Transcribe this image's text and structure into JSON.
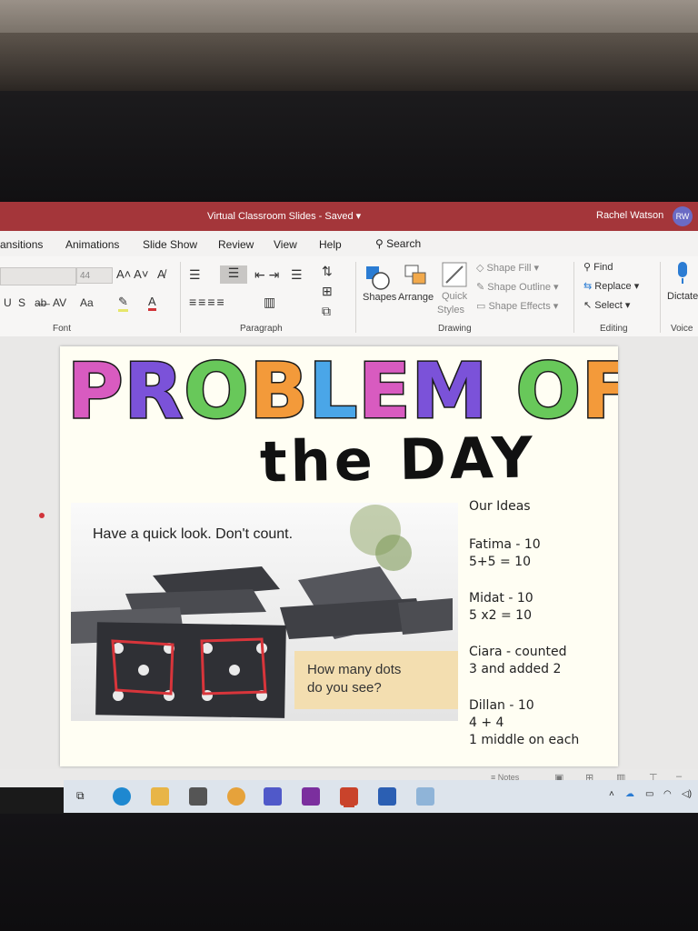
{
  "window": {
    "title": "Virtual Classroom Slides  -  Saved",
    "user": "Rachel Watson",
    "user_initials": "RW"
  },
  "tabs": [
    "ansitions",
    "Animations",
    "Slide Show",
    "Review",
    "View",
    "Help"
  ],
  "search_label": "Search",
  "ribbon": {
    "font_size": "44",
    "groups": [
      "Font",
      "Paragraph",
      "Drawing",
      "Editing",
      "Voice"
    ],
    "drawing": {
      "shapes": "Shapes",
      "arrange": "Arrange",
      "quick_styles_1": "Quick",
      "quick_styles_2": "Styles",
      "shape_fill": "Shape Fill",
      "shape_outline": "Shape Outline",
      "shape_effects": "Shape Effects"
    },
    "editing": {
      "find": "Find",
      "replace": "Replace",
      "select": "Select"
    },
    "voice": {
      "dictate": "Dictate"
    }
  },
  "slide": {
    "title_line1": "PROBLEM OF",
    "title_line2": "the DAY",
    "title_letter_colors": [
      "#d85bc0",
      "#7b52d9",
      "#68c85a",
      "#f39a3a",
      "#4aa6e8",
      "#d85bc0",
      "#7b52d9",
      "#68c85a",
      "#f39a3a"
    ],
    "instruction": "Have a quick look. Don't count.",
    "question_1": "How many dots",
    "question_2": "do you see?",
    "ideas_heading": "Our Ideas",
    "ideas": [
      {
        "line1": "Fatima - 10",
        "line2": "5+5 = 10"
      },
      {
        "line1": "Midat - 10",
        "line2": "5 x2 = 10"
      },
      {
        "line1": "Ciara - counted",
        "line2": "3 and added 2"
      },
      {
        "line1": "Dillan - 10",
        "line2": "4 + 4",
        "line3": "1 middle on each"
      }
    ]
  },
  "statusbar": {
    "notes": "Notes"
  }
}
